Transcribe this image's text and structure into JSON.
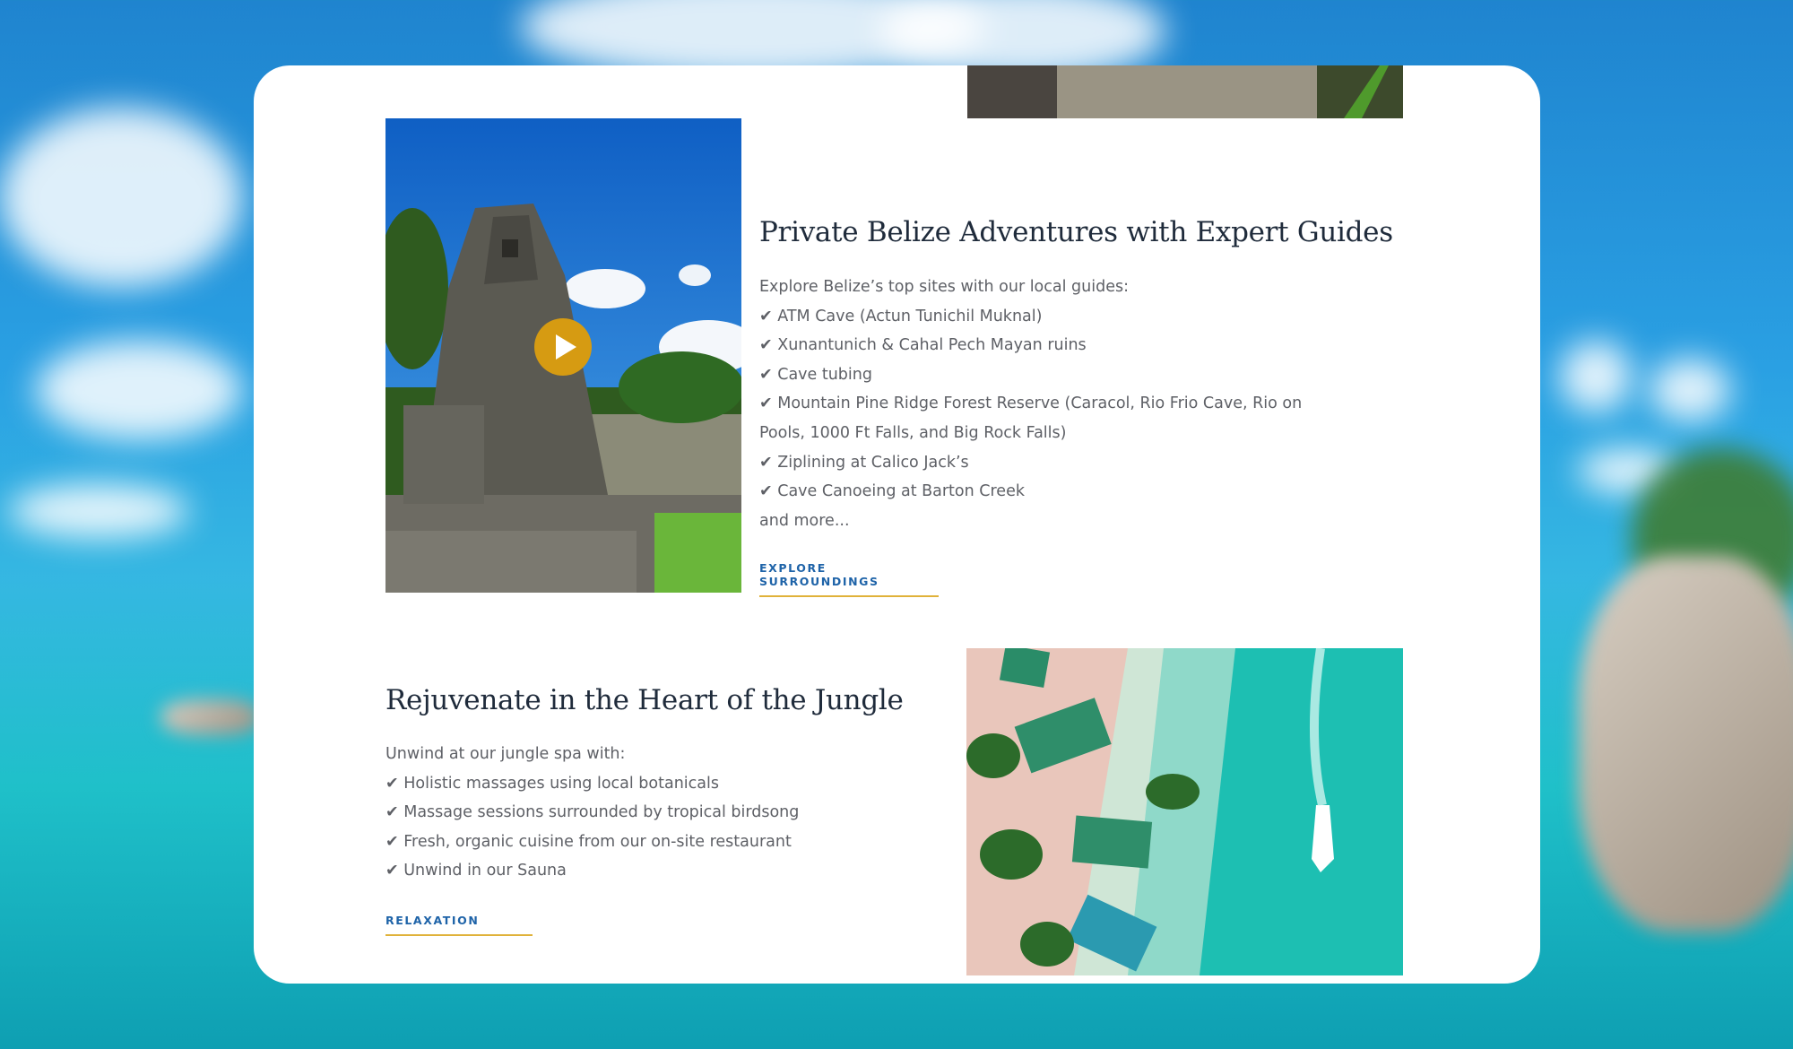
{
  "section_adventures": {
    "heading": "Private Belize Adventures with Expert Guides",
    "intro": "Explore Belize’s top sites with our local guides:",
    "items": [
      "✔ ATM Cave (Actun Tunichil Muknal)",
      "✔ Xunantunich & Cahal Pech Mayan ruins",
      "✔ Cave tubing",
      "✔ Mountain Pine Ridge Forest Reserve (Caracol, Rio Frio Cave, Rio on Pools, 1000 Ft Falls, and Big Rock Falls)",
      "✔ Ziplining at Calico Jack’s",
      "✔ Cave Canoeing at Barton Creek"
    ],
    "outro": "and more...",
    "cta_label": "EXPLORE SURROUNDINGS",
    "image_icon": "play-icon"
  },
  "section_spa": {
    "heading": "Rejuvenate in the Heart of the Jungle",
    "intro": "Unwind at our jungle spa with:",
    "items": [
      "✔ Holistic massages using local botanicals",
      "✔ Massage sessions surrounded by tropical birdsong",
      "✔ Fresh, organic cuisine from our on-site restaurant",
      "✔ Unwind in our Sauna"
    ],
    "cta_label": "RELAXATION"
  },
  "colors": {
    "accent_gold": "#d69b12",
    "link_blue": "#1e63a8",
    "heading": "#1f2b3b",
    "body_text": "#5e6066"
  }
}
